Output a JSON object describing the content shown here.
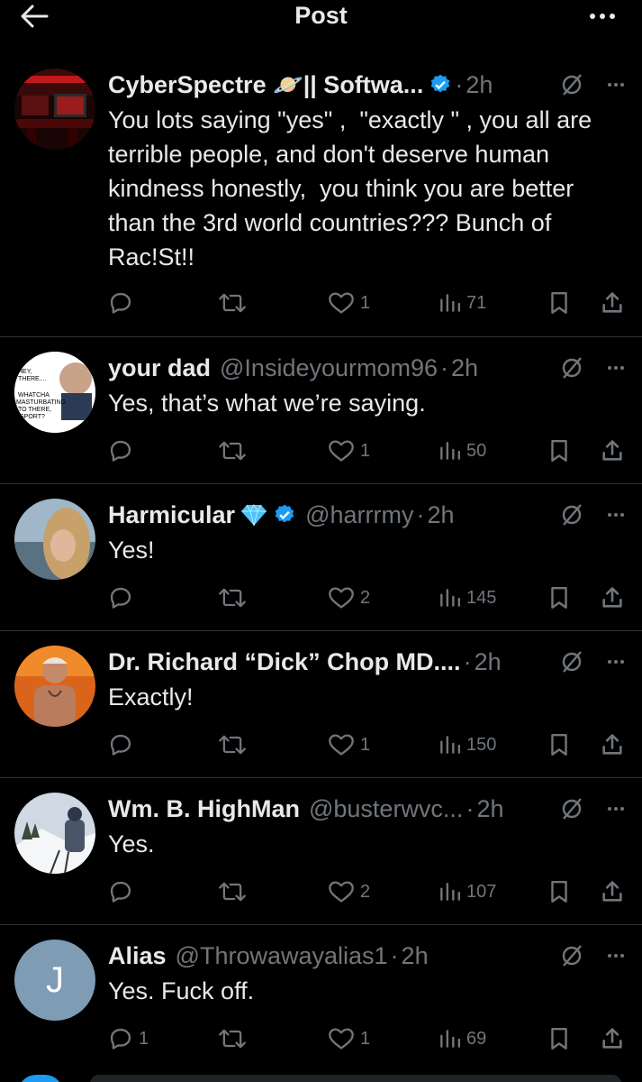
{
  "header": {
    "title": "Post"
  },
  "replies": [
    {
      "name": "CyberSpectre 🪐|| Softwa...",
      "handle": "",
      "time": "2h",
      "verified": true,
      "gem": false,
      "text": "You lots saying \"yes\" ,  \"exactly \" , you all are terrible people, and don't deserve human kindness honestly,  you think you are better than the 3rd world countries??? Bunch of Rac!St!!",
      "reply_count": "",
      "retweet_count": "",
      "like_count": "1",
      "view_count": "71",
      "avatar": "red-room-desk-photo"
    },
    {
      "name": "your dad",
      "handle": "@Insideyourmom96",
      "time": "2h",
      "verified": false,
      "gem": false,
      "text": "Yes, that’s what we’re saying.",
      "reply_count": "",
      "retweet_count": "",
      "like_count": "1",
      "view_count": "50",
      "avatar_meme_text": "HEY, THERE.... WHATCHA MASTURBATING TO THERE, SPORT?"
    },
    {
      "name": "Harmicular",
      "handle": "@harrrmy",
      "time": "2h",
      "verified": true,
      "gem": true,
      "text": "Yes!",
      "reply_count": "",
      "retweet_count": "",
      "like_count": "2",
      "view_count": "145",
      "avatar": "woman-blonde-hair-photo"
    },
    {
      "name": "Dr. Richard “Dick” Chop MD....",
      "handle": "",
      "time": "2h",
      "verified": false,
      "gem": false,
      "text": "Exactly!",
      "reply_count": "",
      "retweet_count": "",
      "like_count": "1",
      "view_count": "150",
      "avatar": "shirtless-man-photo"
    },
    {
      "name": "Wm. B. HighMan",
      "handle": "@busterwvc...",
      "time": "2h",
      "verified": false,
      "gem": false,
      "text": "Yes.",
      "reply_count": "",
      "retweet_count": "",
      "like_count": "2",
      "view_count": "107",
      "avatar": "snow-skier-photo"
    },
    {
      "name": "Alias",
      "handle": "@Throwawayalias1",
      "time": "2h",
      "verified": false,
      "gem": false,
      "text": "Yes. Fuck off.",
      "reply_count": "1",
      "retweet_count": "",
      "like_count": "1",
      "view_count": "69",
      "avatar_letter": "J"
    }
  ],
  "colors": {
    "background": "#000000",
    "text_primary": "#e7e9ea",
    "text_secondary": "#71767b",
    "divider": "#2f3336",
    "verified_blue": "#1d9bf0",
    "letter_avatar": "#7f9cb5"
  }
}
